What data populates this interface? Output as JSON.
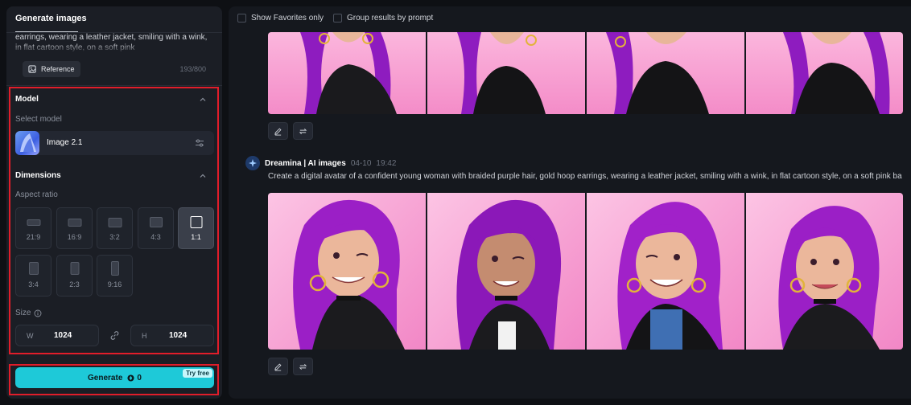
{
  "left_panel": {
    "tab_title": "Generate images",
    "prompt_text": "earrings, wearing a leather jacket, smiling with a wink, in flat cartoon style, on a soft pink",
    "reference_label": "Reference",
    "char_count": "193/800",
    "model": {
      "section_title": "Model",
      "select_label": "Select model",
      "selected_model": "Image 2.1"
    },
    "dimensions": {
      "section_title": "Dimensions",
      "aspect_label": "Aspect ratio",
      "ratios": [
        "21:9",
        "16:9",
        "3:2",
        "4:3",
        "1:1",
        "3:4",
        "2:3",
        "9:16"
      ],
      "selected_ratio": "1:1",
      "size_label": "Size",
      "width_prefix": "W",
      "width_value": "1024",
      "height_prefix": "H",
      "height_value": "1024"
    },
    "generate": {
      "label": "Generate",
      "credits": "0",
      "badge": "Try free"
    }
  },
  "right_panel": {
    "show_favorites_label": "Show Favorites only",
    "group_results_label": "Group results by prompt",
    "generation": {
      "app_name": "Dreamina | AI images",
      "date": "04-10",
      "time": "19:42",
      "prompt": "Create a digital avatar of a confident young woman with braided purple hair, gold hoop earrings, wearing a leather jacket, smiling with a wink, in flat cartoon style, on a soft pink ba"
    }
  },
  "colors": {
    "accent": "#1ec9d8",
    "highlight_border": "#e11d2a",
    "panel_bg": "#1b1e25",
    "image_bg": "#f7a6d8",
    "hair": "#9b1fc6"
  },
  "icons": [
    "reference-icon",
    "chevron-up-icon",
    "settings-sliders-icon",
    "info-icon",
    "link-icon",
    "credit-icon",
    "edit-icon",
    "regenerate-icon",
    "dreamina-logo-icon"
  ]
}
